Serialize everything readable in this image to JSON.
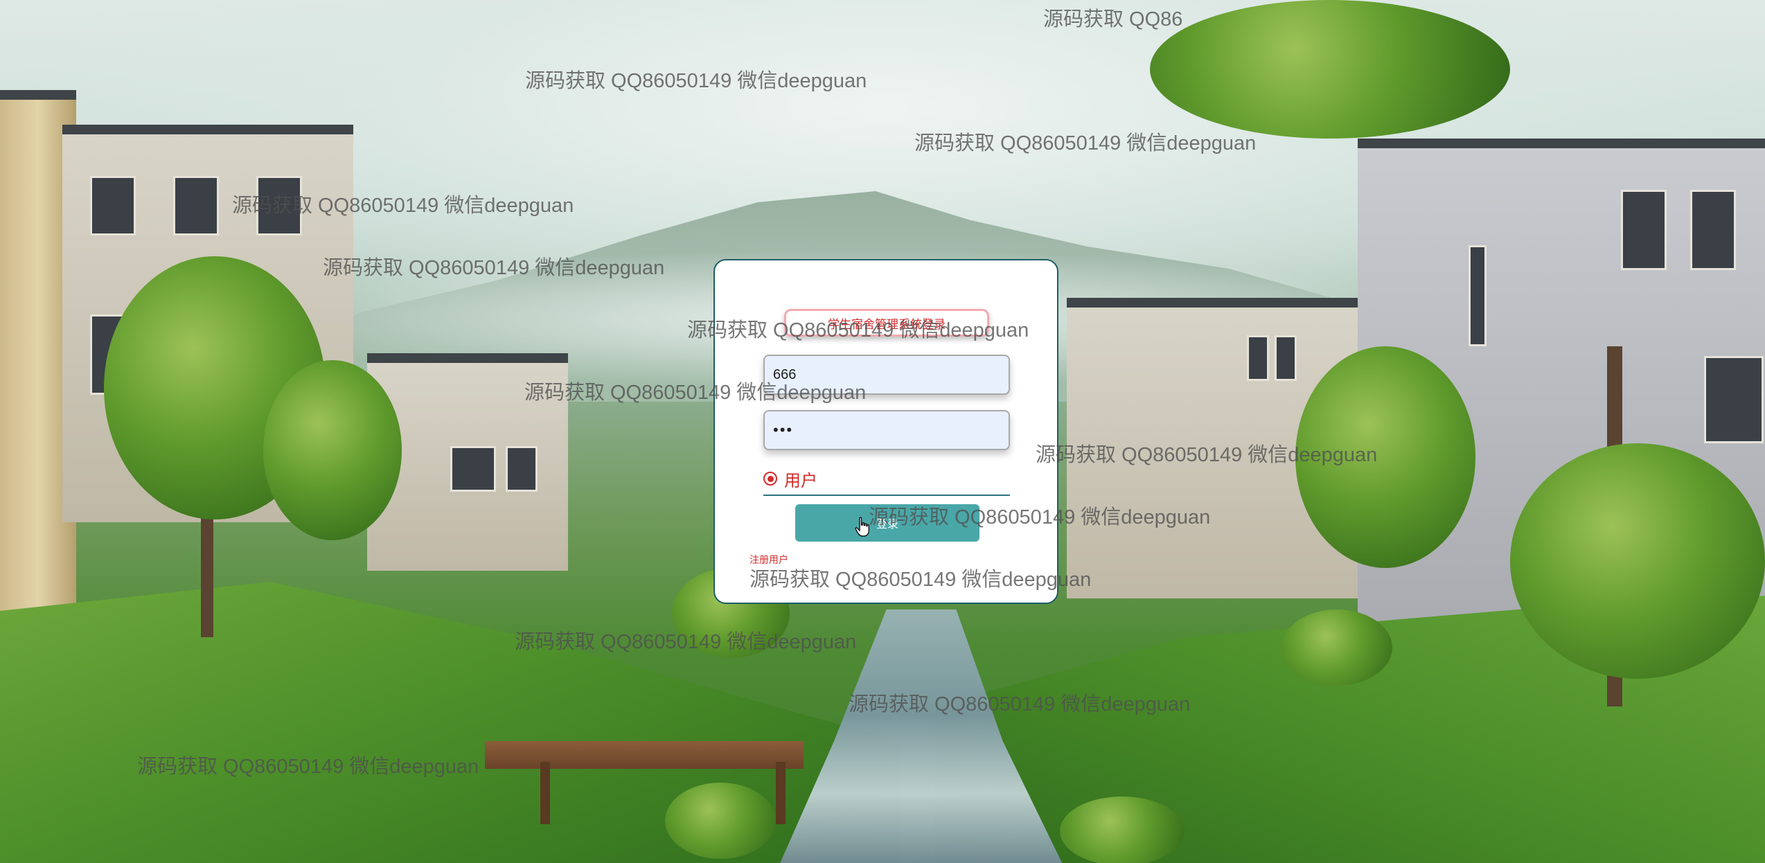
{
  "login": {
    "title_placeholder": "学生宿舍管理系统登录",
    "username_value": "666",
    "password_value": "•••",
    "role_label": "用户",
    "login_button_label": "登录",
    "register_link_label": "注册用户"
  },
  "watermark": {
    "text": "源码获取 QQ86050149 微信deepguan",
    "text_partial": "源码获取 QQ86"
  },
  "colors": {
    "card_border": "#1d5d66",
    "accent_red": "#d42b2b",
    "button_teal": "#4aa7a8",
    "input_fill": "#e8f0fe"
  }
}
